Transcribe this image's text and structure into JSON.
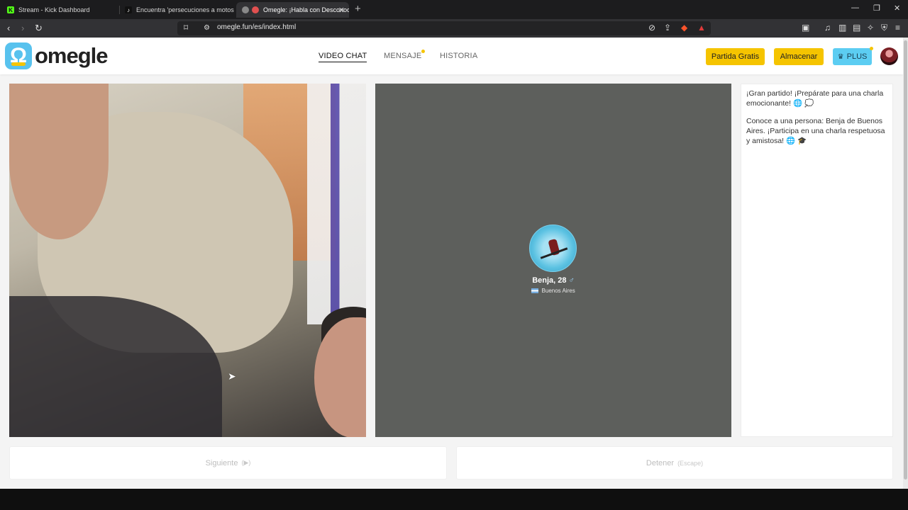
{
  "browser": {
    "tabs": [
      {
        "title": "Stream - Kick Dashboard",
        "icon": "kick-icon"
      },
      {
        "title": "Encuentra 'persecuciones a motos en",
        "icon": "tiktok-icon"
      },
      {
        "title": "Omegle: ¡Habla con Desconoc",
        "icon": "omegle-icon"
      }
    ],
    "new_tab": "+",
    "url": "omegle.fun/es/index.html"
  },
  "site": {
    "logo_text": "omegle",
    "nav": [
      {
        "label": "VIDEO CHAT"
      },
      {
        "label": "MENSAJE"
      },
      {
        "label": "HISTORIA"
      }
    ],
    "buttons": {
      "free_match": "Partida Gratis",
      "store": "Almacenar",
      "plus": "PLUS",
      "plus_icon": "♛"
    },
    "peer": {
      "name": "Benja, 28",
      "gender_icon": "♂",
      "location": "Buenos Aires",
      "flag_icon": "argentina-flag-icon"
    },
    "chat": {
      "messages": [
        "¡Gran partido! ¡Prepárate para una charla emocionante! 🌐 💭",
        "Conoce a una persona: Benja de Buenos Aires. ¡Participa en una charla respetuosa y amistosa! 🌐 🎓"
      ]
    },
    "actions": {
      "next_label": "Siguiente",
      "next_key": "(▶)",
      "stop_label": "Detener",
      "stop_key": "(Escape)"
    }
  },
  "colors": {
    "brand_blue": "#58c2ee",
    "brand_yellow": "#f5c400",
    "peer_background": "#5d5f5c"
  }
}
